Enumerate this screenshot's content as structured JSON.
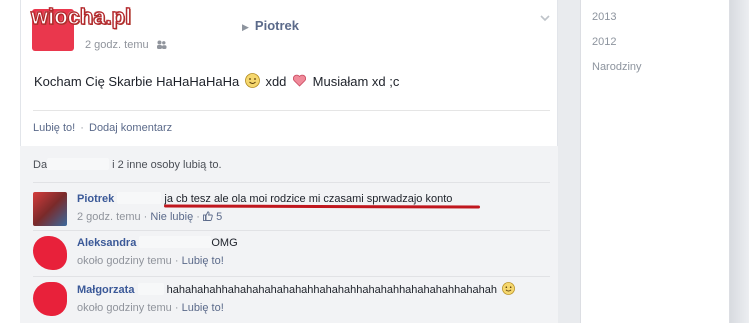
{
  "watermark": "wiocha.pl",
  "post": {
    "recipient": "Piotrek",
    "timestamp": "2 godz. temu",
    "text_part1": "Kocham Cię Skarbie HaHaHaHaHa",
    "text_part2": "xdd",
    "text_part3": "Musiałam xd ;c",
    "icons": {
      "privacy": "friends-icon",
      "arrow": "right-triangle-icon",
      "menu": "chevron-down-icon",
      "emoji1": "smiley-icon",
      "emoji2": "heart-icon"
    }
  },
  "actions": {
    "like": "Lubię to!",
    "separator": "·",
    "comment": "Dodaj komentarz"
  },
  "likes_summary": {
    "prefix": "Da",
    "suffix": "i 2 inne osoby lubią to."
  },
  "comments": [
    {
      "author": "Piotrek",
      "text": "ja cb tesz ale ola moi rodzice mi czasami sprwadzajo konto",
      "time": "2 godz. temu",
      "sep": "·",
      "action": "Nie lubię",
      "likes": "5"
    },
    {
      "author": "Aleksandra",
      "text": "OMG",
      "time": "około godziny temu",
      "sep": "·",
      "action": "Lubię to!"
    },
    {
      "author": "Małgorzata",
      "text": "hahahahahhahahahahahahahhahahahhahahahhahahahahhahahah",
      "time": "około godziny temu",
      "sep": "·",
      "action": "Lubię to!"
    }
  ],
  "timeline": {
    "items": [
      "2013",
      "2012",
      "Narodziny"
    ]
  },
  "colors": {
    "link": "#3b5998",
    "redaction": "#e8213a",
    "underline": "#c0171e",
    "ufi_bg": "#f2f3f5"
  }
}
